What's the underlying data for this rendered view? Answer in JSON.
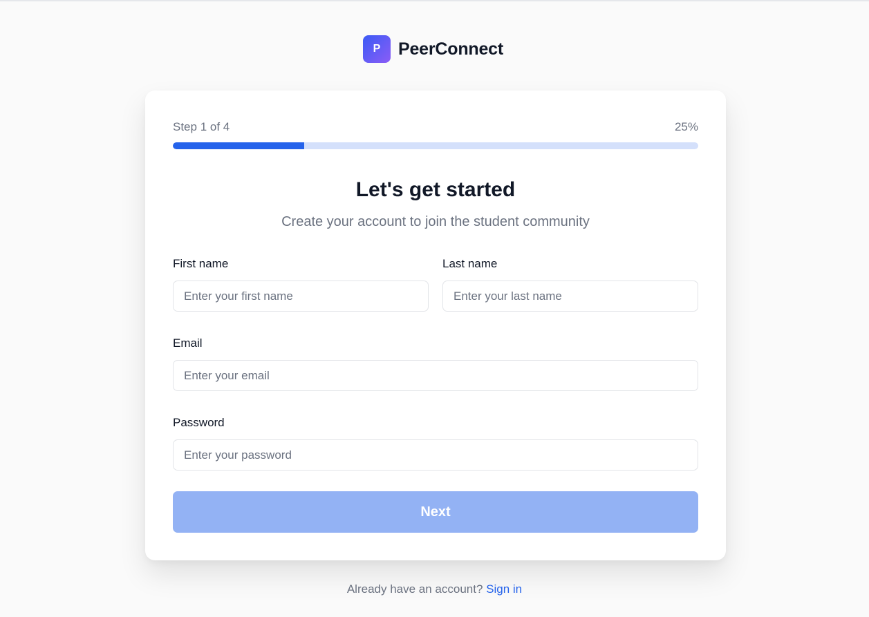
{
  "brand": {
    "logo_letter": "P",
    "name": "PeerConnect"
  },
  "progress": {
    "step_text": "Step 1 of 4",
    "percent_text": "25%",
    "fraction": 0.25,
    "fill_color": "#2563eb",
    "track_color": "#d4e0fb"
  },
  "heading": {
    "title": "Let's get started",
    "subtitle": "Create your account to join the student community"
  },
  "form": {
    "first_name": {
      "label": "First name",
      "placeholder": "Enter your first name",
      "value": ""
    },
    "last_name": {
      "label": "Last name",
      "placeholder": "Enter your last name",
      "value": ""
    },
    "email": {
      "label": "Email",
      "placeholder": "Enter your email",
      "value": ""
    },
    "password": {
      "label": "Password",
      "placeholder": "Enter your password",
      "value": ""
    },
    "next_label": "Next"
  },
  "footer": {
    "prompt": "Already have an account?",
    "link_label": "Sign in"
  },
  "colors": {
    "accent": "#2563eb",
    "button_disabled": "#93b2f4",
    "background": "#fafafa"
  }
}
